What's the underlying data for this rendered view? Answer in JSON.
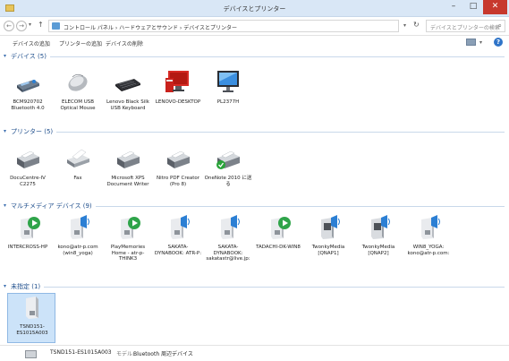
{
  "window": {
    "title": "デバイスとプリンター",
    "min_label": "–",
    "max_label": "□",
    "close_label": "✕"
  },
  "address": {
    "back": "←",
    "forward": "→",
    "up": "↑",
    "crumbs": "コントロール パネル › ハードウェアとサウンド › デバイスとプリンター",
    "search_placeholder": "デバイスとプリンターの検索"
  },
  "toolbar": {
    "add_device": "デバイスの追加",
    "add_printer": "プリンターの追加",
    "remove_device": "デバイスの削除"
  },
  "sections": {
    "devices": {
      "label": "デバイス (5)",
      "items": [
        {
          "name": "BCM920702 Bluetooth 4.0",
          "icon": "bluetooth-adapter-icon"
        },
        {
          "name": "ELECOM USB Optical Mouse",
          "icon": "mouse-icon"
        },
        {
          "name": "Lenovo Black Silk USB Keyboard",
          "icon": "keyboard-icon"
        },
        {
          "name": "LENOVO-DESKTOP",
          "icon": "computer-icon"
        },
        {
          "name": "PL2377H",
          "icon": "monitor-icon"
        }
      ]
    },
    "printers": {
      "label": "プリンター (5)",
      "items": [
        {
          "name": "DocuCentre-IV C2275",
          "icon": "printer-icon"
        },
        {
          "name": "Fax",
          "icon": "fax-icon"
        },
        {
          "name": "Microsoft XPS Document Writer",
          "icon": "printer-icon"
        },
        {
          "name": "Nitro PDF Creator (Pro 8)",
          "icon": "printer-icon"
        },
        {
          "name": "OneNote 2010 に送る",
          "icon": "default-printer-icon"
        }
      ]
    },
    "multimedia": {
      "label": "マルチメディア デバイス (9)",
      "items": [
        {
          "name": "INTERCROSS-HP",
          "icon": "media-server-icon"
        },
        {
          "name": "kono@atr-p.com (win8_yoga)",
          "icon": "media-server-icon"
        },
        {
          "name": "PlayMemories Home - atr-p-THINK3",
          "icon": "media-server-icon"
        },
        {
          "name": "SAKATA-DYNABOOK: ATR-P:",
          "icon": "media-server-icon"
        },
        {
          "name": "SAKATA-DYNABOOK: sakatastr@live.jp:",
          "icon": "media-server-icon"
        },
        {
          "name": "TADACHI-DK-WIN8",
          "icon": "media-server-icon"
        },
        {
          "name": "TwonkyMedia [QNAP1]",
          "icon": "media-server-icon"
        },
        {
          "name": "TwonkyMedia [QNAP2]",
          "icon": "media-server-icon"
        },
        {
          "name": "WIN8_YOGA: kono@atr-p.com:",
          "icon": "media-server-icon"
        }
      ]
    },
    "unspecified": {
      "label": "未指定 (1)",
      "items": [
        {
          "name": "TSND151-ES1015A003",
          "icon": "device-box-icon"
        }
      ]
    }
  },
  "status": {
    "name": "TSND151-ES1015A003",
    "model_label": "モデル:",
    "model": "Bluetooth 周辺デバイス"
  }
}
